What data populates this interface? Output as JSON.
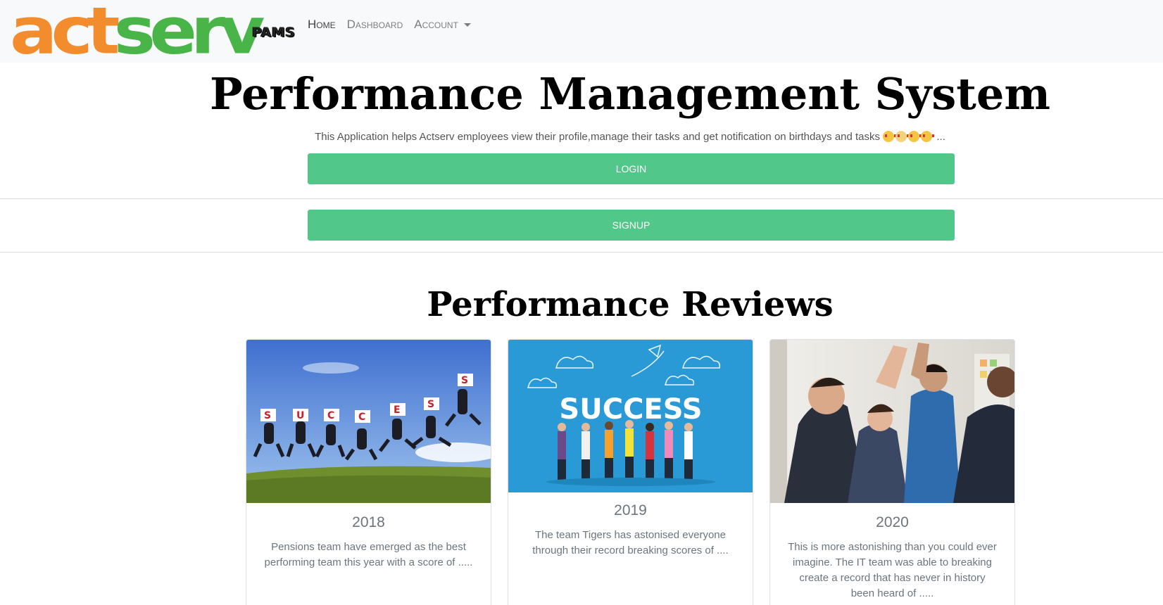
{
  "nav": {
    "logo_act": "act",
    "logo_serv": "serv",
    "app_badge": "PAMS",
    "links": [
      {
        "label": "Home"
      },
      {
        "label": "Dashboard"
      },
      {
        "label": "Account"
      }
    ]
  },
  "hero": {
    "title": "Performance Management System",
    "subtitle": "This Application helps Actserv employees view their profile,manage their tasks and get notification on birthdays and tasks",
    "subtitle_tail": "...",
    "login_label": "LOGIN",
    "signup_label": "SIGNUP"
  },
  "reviews": {
    "title": "Performance Reviews",
    "cards": [
      {
        "year": "2018",
        "text": "Pensions team have emerged as the best performing team this year with a score of .....",
        "image_letters": [
          "S",
          "U",
          "C",
          "C",
          "E",
          "S",
          "S"
        ]
      },
      {
        "year": "2019",
        "text": "The team Tigers has astonised everyone through their record breaking scores of ....",
        "image_word": "SUCCESS"
      },
      {
        "year": "2020",
        "text": "This is more astonishing than you could ever imagine. The IT team was able to breaking create a record that has never in history been heard of ....."
      }
    ]
  },
  "colors": {
    "brand_orange": "#f28c2c",
    "brand_green": "#49b548",
    "button_green": "#52c78a",
    "navbar_bg": "#f8f9fa",
    "card_2019_bg": "#2a9ad6"
  }
}
